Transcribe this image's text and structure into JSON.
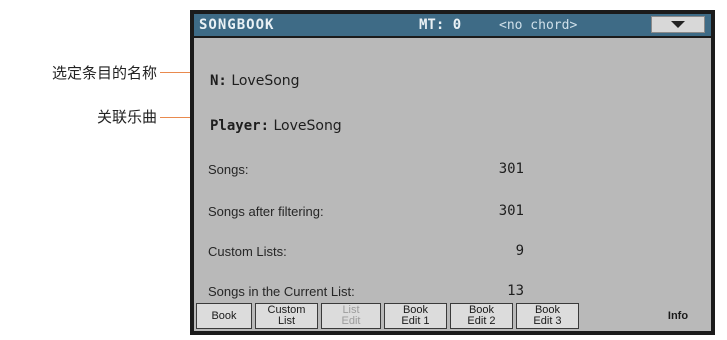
{
  "annotations": {
    "selected_name": "选定条目的名称",
    "linked_song": "关联乐曲"
  },
  "titlebar": {
    "title": "SONGBOOK",
    "mt": "MT: 0",
    "chord": "<no chord>",
    "menu_icon": "triangle-down-icon"
  },
  "info": {
    "name_label": "N:",
    "name_value": "LoveSong",
    "player_label": "Player:",
    "player_value": "LoveSong",
    "rows": [
      {
        "label": "Songs:",
        "value": "301"
      },
      {
        "label": "Songs after filtering:",
        "value": "301"
      },
      {
        "label": "Custom Lists:",
        "value": "9"
      },
      {
        "label": "Songs in the Current List:",
        "value": "13"
      }
    ]
  },
  "tabs": [
    {
      "line1": "Book",
      "line2": ""
    },
    {
      "line1": "Custom",
      "line2": "List"
    },
    {
      "line1": "List",
      "line2": "Edit"
    },
    {
      "line1": "Book",
      "line2": "Edit 1"
    },
    {
      "line1": "Book",
      "line2": "Edit 2"
    },
    {
      "line1": "Book",
      "line2": "Edit 3"
    },
    {
      "line1": "Info",
      "line2": ""
    }
  ],
  "colors": {
    "titlebar": "#3e6b86",
    "panel": "#b9b9b9",
    "leader": "#e98a4e"
  }
}
